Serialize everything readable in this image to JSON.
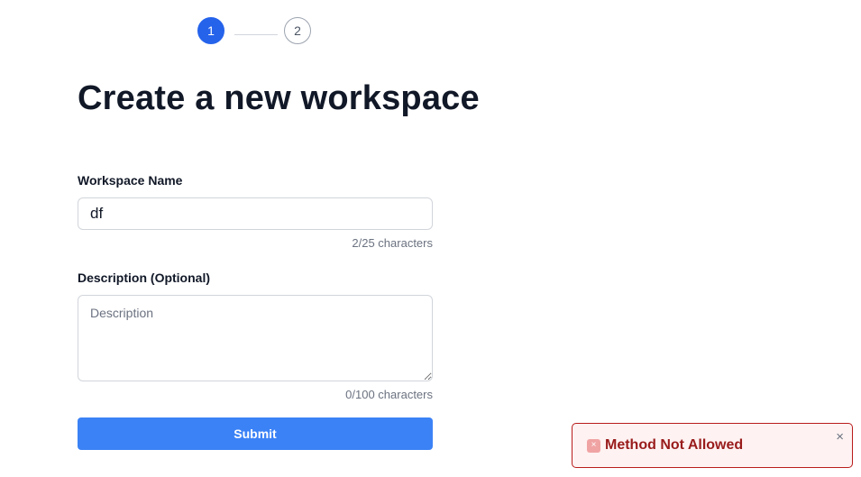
{
  "stepper": {
    "steps": [
      {
        "label": "1",
        "state": "active"
      },
      {
        "label": "2",
        "state": "inactive"
      }
    ]
  },
  "form": {
    "title": "Create a new workspace",
    "name_label": "Workspace Name",
    "name_value": "df",
    "name_counter": "2/25 characters",
    "description_label": "Description (Optional)",
    "description_placeholder": "Description",
    "description_value": "",
    "description_counter": "0/100 characters",
    "submit_label": "Submit"
  },
  "toast": {
    "message": "Method Not Allowed",
    "close_glyph": "×",
    "error_icon_glyph": "×",
    "type": "error"
  },
  "colors": {
    "primary": "#2563eb",
    "submit": "#3b82f6",
    "error_border": "#b91c1c",
    "error_bg": "#fef2f2",
    "error_text": "#991b1b"
  }
}
